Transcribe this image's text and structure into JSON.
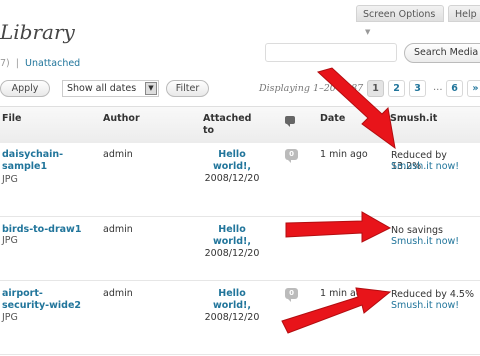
{
  "header": {
    "title": "Library",
    "screen_options_label": "Screen Options",
    "help_label": "Help"
  },
  "subsubsub": {
    "count_fragment": "7)",
    "separator": "|",
    "unattached_label": "Unattached"
  },
  "search": {
    "button_label": "Search Media",
    "input_value": ""
  },
  "filters": {
    "apply_label": "Apply",
    "date_select_value": "Show all dates",
    "filter_label": "Filter"
  },
  "pagination": {
    "displaying_text": "Displaying 1–20 of 87",
    "pages": [
      "1",
      "2",
      "3",
      "6"
    ],
    "ellipsis": "...",
    "next_label": "»",
    "current_page": "1"
  },
  "table": {
    "headers": {
      "file": "File",
      "author": "Author",
      "attached_to": "Attached to",
      "date": "Date",
      "smushit": "Smush.it"
    },
    "rows": [
      {
        "name_line1": "daisychain-",
        "name_line2": "sample1",
        "type": "JPG",
        "author": "admin",
        "attached_title_line1": "Hello",
        "attached_title_line2": "world!,",
        "attached_date": "2008/12/20",
        "comments": "0",
        "date": "1 min ago",
        "smush_status": "Reduced by 13.2%",
        "smush_link": "Smush.it now!"
      },
      {
        "name_line1": "birds-to-draw1",
        "name_line2": "",
        "type": "JPG",
        "author": "admin",
        "attached_title_line1": "Hello",
        "attached_title_line2": "world!,",
        "attached_date": "2008/12/20",
        "comments": "",
        "date": "",
        "smush_status": "No savings",
        "smush_link": "Smush.it now!"
      },
      {
        "name_line1": "airport-",
        "name_line2": "security-wide2",
        "type": "JPG",
        "author": "admin",
        "attached_title_line1": "Hello",
        "attached_title_line2": "world!,",
        "attached_date": "2008/12/20",
        "comments": "0",
        "date": "1 min ago",
        "smush_status": "Reduced by 4.5%",
        "smush_link": "Smush.it now!"
      }
    ]
  },
  "colors": {
    "link": "#21759b",
    "arrow": "#e8141a"
  }
}
